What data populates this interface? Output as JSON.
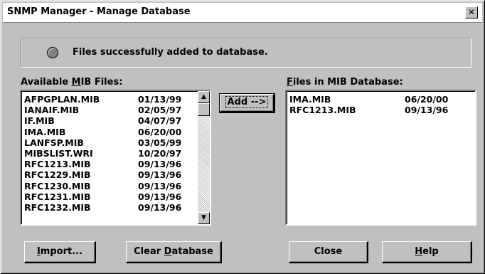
{
  "window": {
    "title": "SNMP Manager - Manage Database",
    "close_glyph": "✕"
  },
  "status": {
    "message": "Files successfully added to database."
  },
  "available": {
    "label_pre": "Available ",
    "label_u": "M",
    "label_post": "IB Files:",
    "files": [
      {
        "name": "AFPGPLAN.MIB",
        "date": "01/13/99"
      },
      {
        "name": "IANAIF.MIB",
        "date": "02/05/97"
      },
      {
        "name": "IF.MIB",
        "date": "04/07/97"
      },
      {
        "name": "IMA.MIB",
        "date": "06/20/00"
      },
      {
        "name": "LANFSP.MIB",
        "date": "03/05/99"
      },
      {
        "name": "MIBSLIST.WRI",
        "date": "10/20/97"
      },
      {
        "name": "RFC1213.MIB",
        "date": "09/13/96"
      },
      {
        "name": "RFC1229.MIB",
        "date": "09/13/96"
      },
      {
        "name": "RFC1230.MIB",
        "date": "09/13/96"
      },
      {
        "name": "RFC1231.MIB",
        "date": "09/13/96"
      },
      {
        "name": "RFC1232.MIB",
        "date": "09/13/96"
      }
    ]
  },
  "database": {
    "label_u": "F",
    "label_post": "iles in MIB Database:",
    "files": [
      {
        "name": "IMA.MIB",
        "date": "06/20/00"
      },
      {
        "name": "RFC1213.MIB",
        "date": "09/13/96"
      }
    ]
  },
  "buttons": {
    "add": "Add -->",
    "import_u": "I",
    "import_post": "mport...",
    "clear_pre": "Clear ",
    "clear_u": "D",
    "clear_post": "atabase",
    "close": "Close",
    "help_u": "H",
    "help_post": "elp"
  },
  "icons": {
    "scroll_up": "▲",
    "scroll_down": "▼"
  }
}
